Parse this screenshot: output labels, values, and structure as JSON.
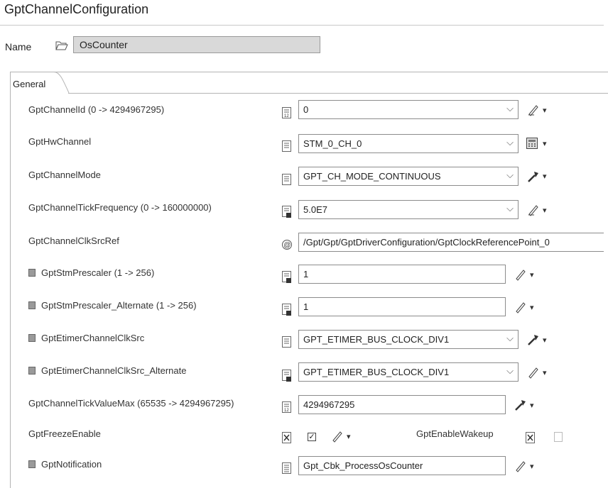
{
  "header": {
    "title": "GptChannelConfiguration"
  },
  "name": {
    "label": "Name",
    "value": "OsCounter"
  },
  "tabs": [
    {
      "label": "General"
    }
  ],
  "rows": [
    {
      "label": "GptChannelId (0 -> 4294967295)",
      "value": "0"
    },
    {
      "label": "GptHwChannel",
      "value": "STM_0_CH_0"
    },
    {
      "label": "GptChannelMode",
      "value": "GPT_CH_MODE_CONTINUOUS"
    },
    {
      "label": "GptChannelTickFrequency (0 -> 160000000)",
      "value": "5.0E7"
    },
    {
      "label": "GptChannelClkSrcRef",
      "value": "/Gpt/Gpt/GptDriverConfiguration/GptClockReferencePoint_0"
    },
    {
      "label": "GptStmPrescaler (1 -> 256)",
      "value": "1"
    },
    {
      "label": "GptStmPrescaler_Alternate (1 -> 256)",
      "value": "1"
    },
    {
      "label": "GptEtimerChannelClkSrc",
      "value": "GPT_ETIMER_BUS_CLOCK_DIV1"
    },
    {
      "label": "GptEtimerChannelClkSrc_Alternate",
      "value": "GPT_ETIMER_BUS_CLOCK_DIV1"
    },
    {
      "label": "GptChannelTickValueMax (65535 -> 4294967295)",
      "value": "4294967295"
    },
    {
      "label": "GptFreezeEnable",
      "checked": true
    },
    {
      "label": "GptNotification",
      "value": "Gpt_Cbk_ProcessOsCounter"
    }
  ],
  "wakeup": {
    "label": "GptEnableWakeup",
    "checked": false
  },
  "glyphs": {
    "chevron": "⌵",
    "dropdown": "▾",
    "check": "✓"
  },
  "icons": {
    "folder": "folder-open-icon",
    "calculator": "calculator-icon",
    "pencil": "pencil-icon",
    "wand": "wand-icon",
    "doc": "document-icon",
    "ref": "reference-at-icon",
    "lock": "lock-icon"
  }
}
